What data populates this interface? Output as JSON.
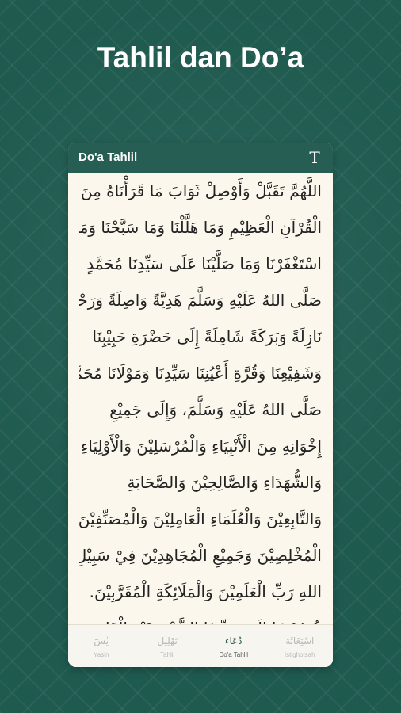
{
  "headline": "Tahlil dan Do’a",
  "appbar": {
    "title": "Do'a Tahlil",
    "text_size_icon": "text-size-icon"
  },
  "content": {
    "lines": [
      "اللَّهُمَّ تَقَبَّلْ وَأَوْصِلْ ثَوَابَ مَا قَرَأْنَاهُ مِنَ",
      "الْقُرْآنِ الْعَظِيْمِ وَمَا هَلَّلْنَا وَمَا سَبَّحْنَا وَمَا",
      "اسْتَغْفَرْنَا وَمَا صَلَّيْنَا عَلَى سَيِّدِنَا مُحَمَّدٍ",
      "صَلَّى اللهُ عَلَيْهِ وَسَلَّمَ هَدِيَّةً وَاصِلَةً وَرَحْمَةً",
      "نَازِلَةً وَبَرَكَةً شَامِلَةً إِلَى حَضْرَةِ حَبِيْبِنَا",
      "وَشَفِيْعِنَا وَقُرَّةِ أَعْيُنِنَا سَيِّدِنَا وَمَوْلَانَا مُحَمَّدٍ",
      "صَلَّى اللهُ عَلَيْهِ وَسَلَّمَ، وَإِلَى جَمِيْعِ",
      "إِخْوَانِهِ مِنَ الْأَنْبِيَاءِ وَالْمُرْسَلِيْنَ وَالْأَوْلِيَاءِ",
      "وَالشُّهَدَاءِ وَالصَّالِحِيْنَ وَالصَّحَابَةِ",
      "وَالتَّابِعِيْنَ وَالْعُلَمَاءِ الْعَامِلِيْنَ وَالْمُصَنِّفِيْنَ",
      "الْمُخْلِصِيْنَ وَجَمِيْعِ الْمُجَاهِدِيْنَ فِيْ سَبِيْلِ",
      "اللهِ رَبِّ الْعَلَمِيْنَ وَالْمَلَائِكَةِ الْمُقَرَّبِيْنَ.",
      "خُصُوْصًا إِلَى سَيِّدِنَا الشَّيْخِ عَبْدِ الْقَادِرِ"
    ]
  },
  "bottom_nav": [
    {
      "glyph": "يٰسٓ",
      "label": "Yasin",
      "active": false
    },
    {
      "glyph": "تَهْلِيل",
      "label": "Tahlil",
      "active": false
    },
    {
      "glyph": "دُعَاء",
      "label": "Do'a Tahlil",
      "active": true
    },
    {
      "glyph": "اسْتِغَاثَة",
      "label": "Istighotsah",
      "active": false
    }
  ]
}
